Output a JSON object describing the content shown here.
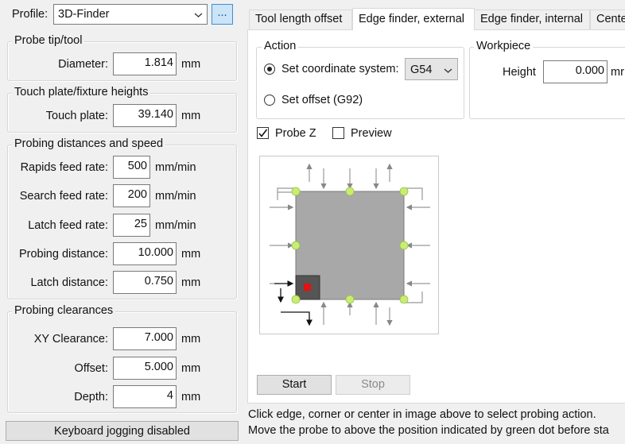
{
  "profile": {
    "label": "Profile:",
    "value": "3D-Finder",
    "more_button": "..."
  },
  "probe_tip": {
    "title": "Probe tip/tool",
    "diameter_label": "Diameter:",
    "diameter_value": "1.814",
    "unit": "mm"
  },
  "touch_plate": {
    "title": "Touch plate/fixture heights",
    "label": "Touch plate:",
    "value": "39.140",
    "unit": "mm"
  },
  "probing": {
    "title": "Probing distances and speed",
    "rows": [
      {
        "label": "Rapids feed rate:",
        "value": "500",
        "unit": "mm/min"
      },
      {
        "label": "Search feed rate:",
        "value": "200",
        "unit": "mm/min"
      },
      {
        "label": "Latch feed rate:",
        "value": "25",
        "unit": "mm/min"
      },
      {
        "label": "Probing distance:",
        "value": "10.000",
        "unit": "mm"
      },
      {
        "label": "Latch distance:",
        "value": "0.750",
        "unit": "mm"
      }
    ]
  },
  "clearances": {
    "title": "Probing clearances",
    "rows": [
      {
        "label": "XY Clearance:",
        "value": "7.000",
        "unit": "mm"
      },
      {
        "label": "Offset:",
        "value": "5.000",
        "unit": "mm"
      },
      {
        "label": "Depth:",
        "value": "4",
        "unit": "mm"
      }
    ]
  },
  "keyboard_jogging": "Keyboard jogging disabled",
  "tabs": [
    "Tool length offset",
    "Edge finder, external",
    "Edge finder, internal",
    "Cente"
  ],
  "action": {
    "title": "Action",
    "set_cs_label": "Set coordinate system:",
    "cs_value": "G54",
    "set_offset_label": "Set offset (G92)"
  },
  "workpiece": {
    "title": "Workpiece",
    "height_label": "Height",
    "height_value": "0.000",
    "unit_partial": "mr"
  },
  "probe_z_label": "Probe Z",
  "preview_label": "Preview",
  "start_label": "Start",
  "stop_label": "Stop",
  "info_line1": "Click edge, corner or center in image above to select probing action.",
  "info_line2": "Move the probe to above the position indicated by green dot before sta",
  "colors": {
    "selected_marker": "#e81010",
    "probe_dot": "#c8ee70",
    "plate": "#a8a8a8"
  }
}
